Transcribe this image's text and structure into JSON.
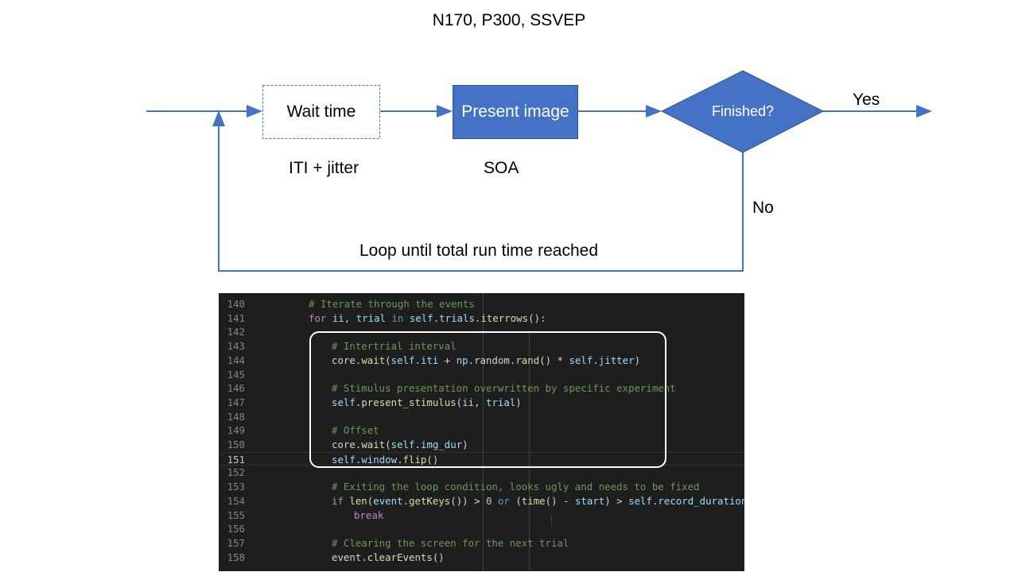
{
  "title": "N170, P300, SSVEP",
  "nodes": {
    "wait": {
      "label": "Wait time",
      "caption": "ITI + jitter"
    },
    "present": {
      "label": "Present image",
      "caption": "SOA"
    },
    "decision": {
      "label": "Finished?"
    }
  },
  "edges": {
    "yes_label": "Yes",
    "no_label": "No",
    "loop_label": "Loop until total run time reached"
  },
  "colors": {
    "accent": "#4472c4",
    "dashed_border": "#4472c4",
    "code_bg": "#1e1e1e"
  },
  "code": {
    "current_line": "151",
    "lines": [
      {
        "no": "140",
        "tokens": [
          [
            "t-cmt",
            "# Iterate through the events"
          ]
        ]
      },
      {
        "no": "141",
        "tokens": [
          [
            "t-kw",
            "for "
          ],
          [
            "t-var",
            "ii"
          ],
          [
            "t-def",
            ", "
          ],
          [
            "t-var",
            "trial "
          ],
          [
            "t-kwb",
            "in "
          ],
          [
            "t-var",
            "self"
          ],
          [
            "t-def",
            "."
          ],
          [
            "t-var",
            "trials"
          ],
          [
            "t-def",
            "."
          ],
          [
            "t-fn",
            "iterrows"
          ],
          [
            "t-def",
            "():"
          ]
        ]
      },
      {
        "no": "142",
        "tokens": []
      },
      {
        "no": "143",
        "tokens": [
          [
            "t-cmt",
            "# Intertrial interval"
          ]
        ]
      },
      {
        "no": "144",
        "tokens": [
          [
            "t-def",
            "core."
          ],
          [
            "t-fn",
            "wait"
          ],
          [
            "t-def",
            "("
          ],
          [
            "t-var",
            "self"
          ],
          [
            "t-def",
            "."
          ],
          [
            "t-var",
            "iti"
          ],
          [
            "t-def",
            " + "
          ],
          [
            "t-var",
            "np"
          ],
          [
            "t-def",
            ".random."
          ],
          [
            "t-fn",
            "rand"
          ],
          [
            "t-def",
            "() * "
          ],
          [
            "t-var",
            "self"
          ],
          [
            "t-def",
            "."
          ],
          [
            "t-var",
            "jitter"
          ],
          [
            "t-def",
            ")"
          ]
        ]
      },
      {
        "no": "145",
        "tokens": []
      },
      {
        "no": "146",
        "tokens": [
          [
            "t-cmt",
            "# Stimulus presentation overwritten by specific experiment"
          ]
        ]
      },
      {
        "no": "147",
        "tokens": [
          [
            "t-var",
            "self"
          ],
          [
            "t-def",
            "."
          ],
          [
            "t-fn",
            "present_stimulus"
          ],
          [
            "t-def",
            "("
          ],
          [
            "t-var",
            "ii"
          ],
          [
            "t-def",
            ", "
          ],
          [
            "t-var",
            "trial"
          ],
          [
            "t-def",
            ")"
          ]
        ]
      },
      {
        "no": "148",
        "tokens": []
      },
      {
        "no": "149",
        "tokens": [
          [
            "t-cmt",
            "# Offset"
          ]
        ]
      },
      {
        "no": "150",
        "tokens": [
          [
            "t-def",
            "core."
          ],
          [
            "t-fn",
            "wait"
          ],
          [
            "t-def",
            "("
          ],
          [
            "t-var",
            "self"
          ],
          [
            "t-def",
            "."
          ],
          [
            "t-var",
            "img_dur"
          ],
          [
            "t-def",
            ")"
          ]
        ]
      },
      {
        "no": "151",
        "tokens": [
          [
            "t-var",
            "self"
          ],
          [
            "t-def",
            "."
          ],
          [
            "t-var",
            "window"
          ],
          [
            "t-def",
            "."
          ],
          [
            "t-fn",
            "flip"
          ],
          [
            "t-def",
            "()"
          ]
        ]
      },
      {
        "no": "152",
        "tokens": []
      },
      {
        "no": "153",
        "tokens": [
          [
            "t-cmt",
            "# Exiting the loop condition, looks ugly and needs to be fixed"
          ]
        ]
      },
      {
        "no": "154",
        "tokens": [
          [
            "t-kw",
            "if "
          ],
          [
            "t-fn",
            "len"
          ],
          [
            "t-def",
            "("
          ],
          [
            "t-var",
            "event"
          ],
          [
            "t-def",
            "."
          ],
          [
            "t-fn",
            "getKeys"
          ],
          [
            "t-def",
            "()) > "
          ],
          [
            "t-num",
            "0"
          ],
          [
            "t-kwb",
            " or "
          ],
          [
            "t-def",
            "("
          ],
          [
            "t-fn",
            "time"
          ],
          [
            "t-def",
            "() - "
          ],
          [
            "t-var",
            "start"
          ],
          [
            "t-def",
            ") > "
          ],
          [
            "t-var",
            "self"
          ],
          [
            "t-def",
            "."
          ],
          [
            "t-var",
            "record_duration"
          ],
          [
            "t-def",
            ":"
          ]
        ]
      },
      {
        "no": "155",
        "tokens": [
          [
            "t-kw",
            "break"
          ]
        ]
      },
      {
        "no": "156",
        "tokens": []
      },
      {
        "no": "157",
        "tokens": [
          [
            "t-cmt",
            "# Clearing the screen for the next trial"
          ]
        ]
      },
      {
        "no": "158",
        "tokens": [
          [
            "t-def",
            "event."
          ],
          [
            "t-fn",
            "clearEvents"
          ],
          [
            "t-def",
            "()"
          ]
        ]
      }
    ]
  }
}
